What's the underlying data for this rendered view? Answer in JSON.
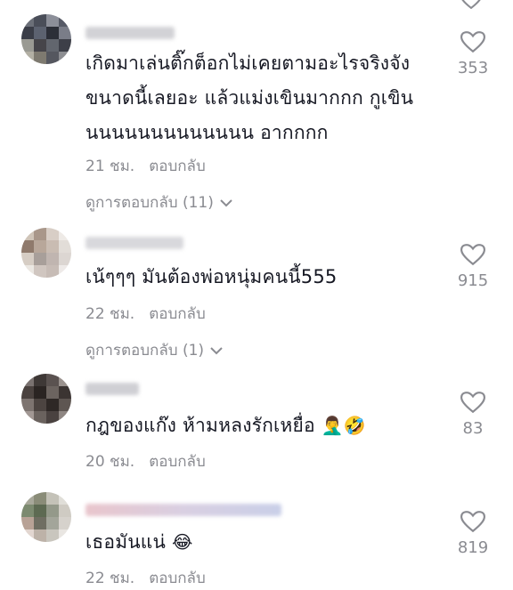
{
  "comments": [
    {
      "text_lines": [
        "เกิดมาเล่นติ๊กต็อกไม่เคยตามอะไรจริงจัง",
        "ขนาดนี้เลยอะ แล้วแม่งเขินมากกก กูเขิน",
        "นนนนนนนนนนนนน อากกกก"
      ],
      "time": "21 ชม.",
      "reply_label": "ตอบกลับ",
      "likes": "353",
      "view_replies": "ดูการตอบกลับ (11)"
    },
    {
      "text_lines": [
        "เน้ๆๆๆ มันต้องพ่อหนุ่มคนนี้555"
      ],
      "time": "22 ชม.",
      "reply_label": "ตอบกลับ",
      "likes": "915",
      "view_replies": "ดูการตอบกลับ (1)"
    },
    {
      "text_lines": [
        "กฎของแก๊ง ห้ามหลงรักเหยื่อ"
      ],
      "emoji": "🤦‍♂️🤣",
      "time": "20 ชม.",
      "reply_label": "ตอบกลับ",
      "likes": "83"
    },
    {
      "text_lines": [
        "เธอมันแน่"
      ],
      "emoji": "😂",
      "time": "22 ชม.",
      "reply_label": "ตอบกลับ",
      "likes": "819"
    }
  ],
  "colors": {
    "text": "#161823",
    "meta": "#8a8b91",
    "heart_stroke": "#8a8b91"
  },
  "icons": {
    "like": "heart-outline-icon",
    "expand": "chevron-down-icon"
  }
}
